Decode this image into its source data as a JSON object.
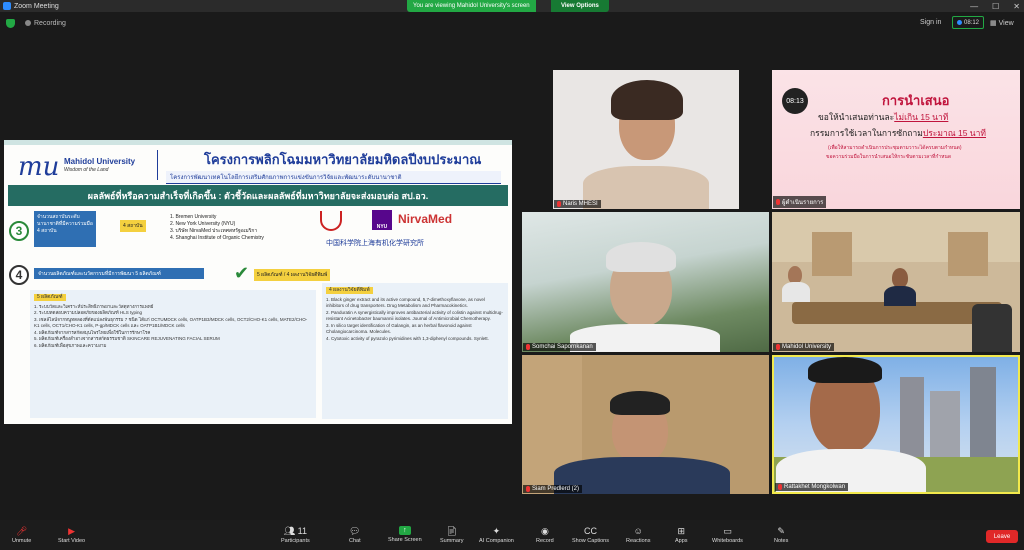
{
  "app": {
    "title": "Zoom Meeting"
  },
  "banner": {
    "viewing": "You are viewing Mahidol University's screen",
    "view_options": "View Options"
  },
  "status": {
    "recording": "Recording",
    "sign_in": "Sign in",
    "timer": "08:12",
    "view": "View"
  },
  "shared_slide": {
    "logo_text": "mu",
    "org_name": "Mahidol University",
    "org_tagline": "Wisdom of the Land",
    "title": "โครงการพลิกโฉมมหาวิทยาลัยมหิดลปีงบประมาณ 2565",
    "subtitle": "โครงการพัฒนาเทคโนโลยีการเสริมศักยภาพการแข่งขันการวิจัยและพัฒนาระดับนานาชาติ",
    "banner": "ผลลัพธ์ที่หรือความสำเร็จที่เกิดขึ้น : ตัวชี้วัดและผลลัพธ์ที่มหาวิทยาลัยจะส่งมอบต่อ สป.อว.",
    "step3": {
      "number": "3",
      "box": "จำนวนสถาบันระดับนานาชาติที่มีความร่วมมือ 4 สถาบัน",
      "badge": "4 สถาบัน",
      "institutions": [
        "1. Bremen University",
        "2. New York University (NYU)",
        "3. บริษัท NirvaMed ประเทศสหรัฐอเมริกา",
        "4. Shanghai Institute of Organic Chemistry"
      ],
      "logo_nirva": "NirvaMed",
      "logo_nyu": "NYU",
      "logo_sh": "中国科学院上海有机化学研究所"
    },
    "step4": {
      "number": "4",
      "box": "จำนวนผลิตภัณฑ์และนวัตกรรมที่มีการพัฒนา 5 ผลิตภัณฑ์",
      "badge": "5 ผลิตภัณฑ์ / 4 ผลงานวิจัยตีพิมพ์"
    },
    "products": {
      "header": "5 ผลิตภัณฑ์",
      "items": [
        "1. ระบบวัดและวิเคราะห์ประสิทธิภาพยาและวัสดุทางการแพทย์",
        "2. ระบบทดสอบความปลอดภัยของผลิตภัณฑ์ HLS typing",
        "3. เซลล์ไลน์จากหนูทดลองที่ดัดแปลงพันธุกรรม 7 ชนิด ได้แก่ OCTUMDCK cells, OATP1B3/MDCK cells, OCT2/CHO-K1 cells, MATE2/CHO-K1 cells, OCT1/CHO-K1 cells, P-gp/MDCK cells และ OATP1B1/MDCK cells",
        "4. ผลิตภัณฑ์จากสารสกัดสมุนไพรไทยเพื่อใช้ในการรักษาโรค",
        "5. ผลิตภัณฑ์เครื่องสำอางจากสารสกัดธรรมชาติ SKINCARE REJUVENATING FACIAL SERUM",
        "6. ผลิตภัณฑ์เพื่อสุขภาพและความงาม"
      ]
    },
    "publications": {
      "header": "4 ผลงานวิจัยตีพิมพ์",
      "items": [
        "1. Black ginger extract and its active compound, 5,7-dimethoxyflavone, as novel inhibitors of drug transporters. Drug Metabolism and Pharmacokinetics.",
        "2. Panduratin A synergistically improves antibacterial activity of colistin against multidrug-resistant Acinetobacter baumannii isolates. Journal of Antimicrobial Chemotherapy.",
        "3. In silico target identification of Galangin, as an herbal flavonoid against Cholangiocarcinoma. Molecules.",
        "4. Cytotoxic activity of pyrazolo pyrimidines with 1,3-diphenyl compounds. Synlett."
      ]
    }
  },
  "participants": [
    {
      "name": "Naris MHESI"
    },
    {
      "name": "ผู้ดำเนินรายการ",
      "slide": {
        "timer": "08:13",
        "heading": "การนำเสนอ",
        "line1_pre": "ขอให้นำเสนอท่านละ",
        "line1_red": "ไม่เกิน 15 นาที",
        "line2_pre": "กรรมการใช้เวลาในการซักถาม",
        "line2_red": "ประมาณ 15 นาที",
        "note1": "(เพื่อให้สามารถดำเนินการประชุมตามวาระได้ครบตามกำหนด)",
        "note2": "ขอความร่วมมือในการนำเสนอให้กระชับตามเวลาที่กำหนด"
      }
    },
    {
      "name": "Somchai Sapornkanan"
    },
    {
      "name": "Mahidol University"
    },
    {
      "name": "Siam Predlerd (2)"
    },
    {
      "name": "Rattakhet Mongkolwan"
    }
  ],
  "toolbar": {
    "unmute": "Unmute",
    "start_video": "Start Video",
    "participants": "Participants",
    "participants_count": "11",
    "chat": "Chat",
    "share_screen": "Share Screen",
    "summary": "Summary",
    "ai_companion": "AI Companion",
    "record": "Record",
    "show_captions": "Show Captions",
    "reactions": "Reactions",
    "apps": "Apps",
    "whiteboards": "Whiteboards",
    "notes": "Notes",
    "leave": "Leave"
  }
}
